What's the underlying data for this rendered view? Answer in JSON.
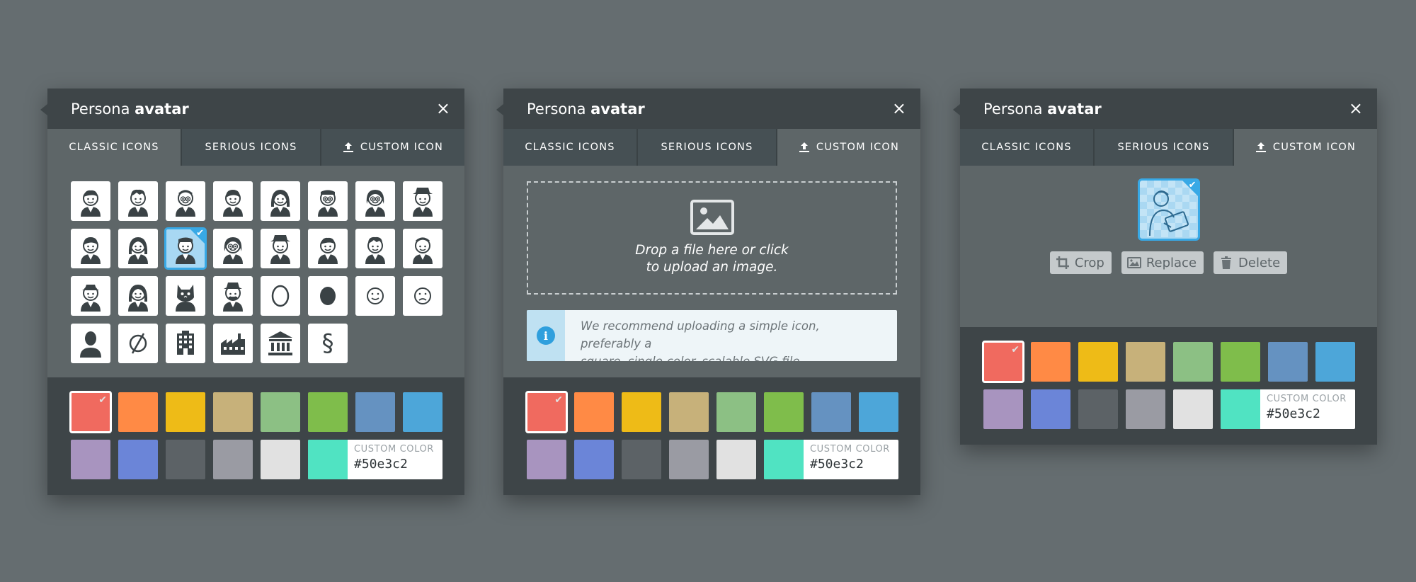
{
  "panels": [
    {
      "title_prefix": "Persona",
      "title_bold": "avatar",
      "close_icon": "×",
      "tabs": [
        "CLASSIC ICONS",
        "SERIOUS ICONS",
        "CUSTOM ICON"
      ],
      "active_tab": 0,
      "special_symbols": [
        "§"
      ],
      "colors": {
        "swatches": [
          "#f06a5f",
          "#ff8a45",
          "#eebb17",
          "#c7b17a",
          "#8cc084",
          "#7fbd4b",
          "#6592c1",
          "#4da6d9",
          "#a894bf",
          "#6b85d8",
          "#5c6266",
          "#9a9ba3",
          "#e1e1e1"
        ],
        "selected_index": 0,
        "check": "✔",
        "custom_label": "CUSTOM COLOR",
        "custom_value": "#50e3c2",
        "custom_chip": "#50e3c2"
      }
    },
    {
      "title_prefix": "Persona",
      "title_bold": "avatar",
      "close_icon": "×",
      "tabs": [
        "CLASSIC ICONS",
        "SERIOUS ICONS",
        "CUSTOM ICON"
      ],
      "active_tab": 2,
      "dropzone_line1": "Drop a file here or click",
      "dropzone_line2": "to upload an image.",
      "notice_line1": "We recommend uploading a simple icon, preferably a",
      "notice_line2": "square, single-color, scalable SVG file.",
      "notice_icon": "i",
      "colors": {
        "check": "✔",
        "custom_label": "CUSTOM COLOR",
        "custom_value": "#50e3c2"
      }
    },
    {
      "title_prefix": "Persona",
      "title_bold": "avatar",
      "close_icon": "×",
      "tabs": [
        "CLASSIC ICONS",
        "SERIOUS ICONS",
        "CUSTOM ICON"
      ],
      "active_tab": 2,
      "actions": [
        "Crop",
        "Replace",
        "Delete"
      ],
      "colors": {
        "check": "✔",
        "custom_label": "CUSTOM COLOR",
        "custom_value": "#50e3c2"
      }
    }
  ]
}
